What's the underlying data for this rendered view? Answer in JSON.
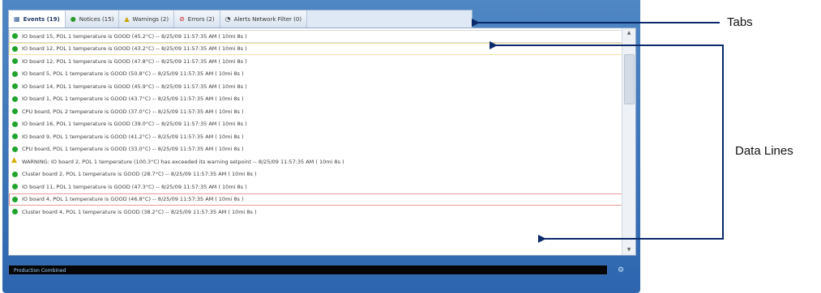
{
  "tabs": [
    {
      "label": "Events (19)",
      "icon": "grid-icon",
      "active": true
    },
    {
      "label": "Notices (15)",
      "icon": "info-icon",
      "active": false
    },
    {
      "label": "Warnings (2)",
      "icon": "warning-icon",
      "active": false
    },
    {
      "label": "Errors (2)",
      "icon": "error-icon",
      "active": false
    },
    {
      "label": "Alerts Network Filter (0)",
      "icon": "alert-icon",
      "active": false
    }
  ],
  "lines": [
    {
      "text": "IO board 15, POL 1 temperature is GOOD (45.2°C) -- 8/25/09 11:57:35 AM ( 10mi 8s )",
      "level": "ok",
      "style": "sel-plain"
    },
    {
      "text": "IO board 12, POL 1 temperature is GOOD (43.2°C) -- 8/25/09 11:57:35 AM ( 10mi 8s )",
      "level": "ok",
      "style": "sel-yellow"
    },
    {
      "text": "IO board 12, POL 1 temperature is GOOD (47.8°C) -- 8/25/09 11:57:35 AM ( 10mi 8s )",
      "level": "ok",
      "style": ""
    },
    {
      "text": "IO board 5, POL 1 temperature is GOOD (50.8°C) -- 8/25/09 11:57:35 AM ( 10mi 8s )",
      "level": "ok",
      "style": ""
    },
    {
      "text": "IO board 14, POL 1 temperature is GOOD (45.9°C) -- 8/25/09 11:57:35 AM ( 10mi 8s )",
      "level": "ok",
      "style": ""
    },
    {
      "text": "IO board 1, POL 1 temperature is GOOD (43.7°C) -- 8/25/09 11:57:35 AM ( 10mi 8s )",
      "level": "ok",
      "style": ""
    },
    {
      "text": "CPU board, POL 2 temperature is GOOD (37.0°C) -- 8/25/09 11:57:35 AM ( 10mi 8s )",
      "level": "ok",
      "style": ""
    },
    {
      "text": "IO board 16, POL 1 temperature is GOOD (39.0°C) -- 8/25/09 11:57:35 AM ( 10mi 8s )",
      "level": "ok",
      "style": ""
    },
    {
      "text": "IO board 9, POL 1 temperature is GOOD (41.2°C) -- 8/25/09 11:57:35 AM ( 10mi 8s )",
      "level": "ok",
      "style": ""
    },
    {
      "text": "CPU board, POL 1 temperature is GOOD (33.0°C) -- 8/25/09 11:57:35 AM ( 10mi 8s )",
      "level": "ok",
      "style": ""
    },
    {
      "text": "WARNING: IO board 2, POL 1 temperature (100.3°C) has exceeded its warning setpoint -- 8/25/09 11:57:35 AM ( 10mi 8s )",
      "level": "warn",
      "style": ""
    },
    {
      "text": "Cluster board 2, POL 1 temperature is GOOD (28.7°C) -- 8/25/09 11:57:35 AM ( 10mi 8s )",
      "level": "ok",
      "style": ""
    },
    {
      "text": "IO board 11, POL 1 temperature is GOOD (47.3°C) -- 8/25/09 11:57:35 AM ( 10mi 8s )",
      "level": "ok",
      "style": ""
    },
    {
      "text": "IO board 4, POL 1 temperature is GOOD (46.8°C) -- 8/25/09 11:57:35 AM ( 10mi 8s )",
      "level": "ok",
      "style": "sel-red"
    },
    {
      "text": "Cluster board 4, POL 1 temperature is GOOD (38.2°C) -- 8/25/09 11:57:35 AM ( 10mi 8s )",
      "level": "ok",
      "style": ""
    }
  ],
  "status": {
    "text": "Production Combined"
  },
  "callouts": {
    "tabs": "Tabs",
    "data_lines": "Data Lines"
  },
  "colors": {
    "window_frame": "#2d66ae",
    "ok_dot": "#22a32c",
    "warning": "#d4b000",
    "selection_red": "#e89a9a",
    "selection_yellow": "#f2e4a0"
  }
}
